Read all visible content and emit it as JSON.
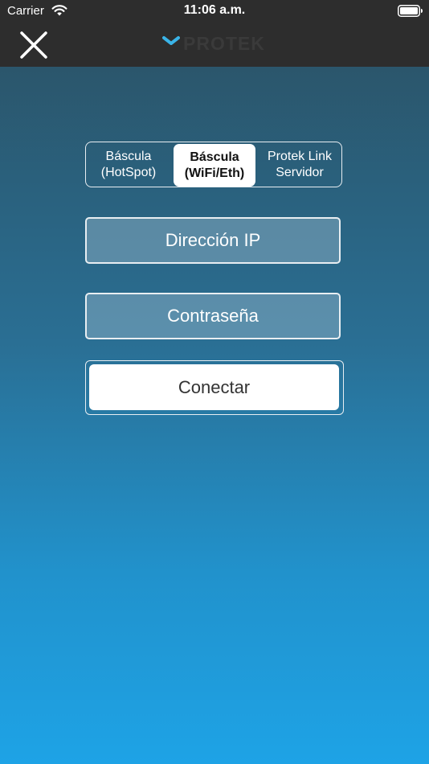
{
  "status_bar": {
    "carrier": "Carrier",
    "time": "11:06 a.m."
  },
  "header": {
    "logo_text": "PROTEK",
    "logo_color": "#3ab4e8",
    "close_icon": "close-icon"
  },
  "segments": [
    {
      "label": "Báscula\n(HotSpot)",
      "selected": false
    },
    {
      "label": "Báscula\n(WiFi/Eth)",
      "selected": true
    },
    {
      "label": "Protek Link\nServidor",
      "selected": false
    }
  ],
  "form": {
    "ip_placeholder": "Dirección IP",
    "password_placeholder": "Contraseña",
    "connect_label": "Conectar"
  }
}
